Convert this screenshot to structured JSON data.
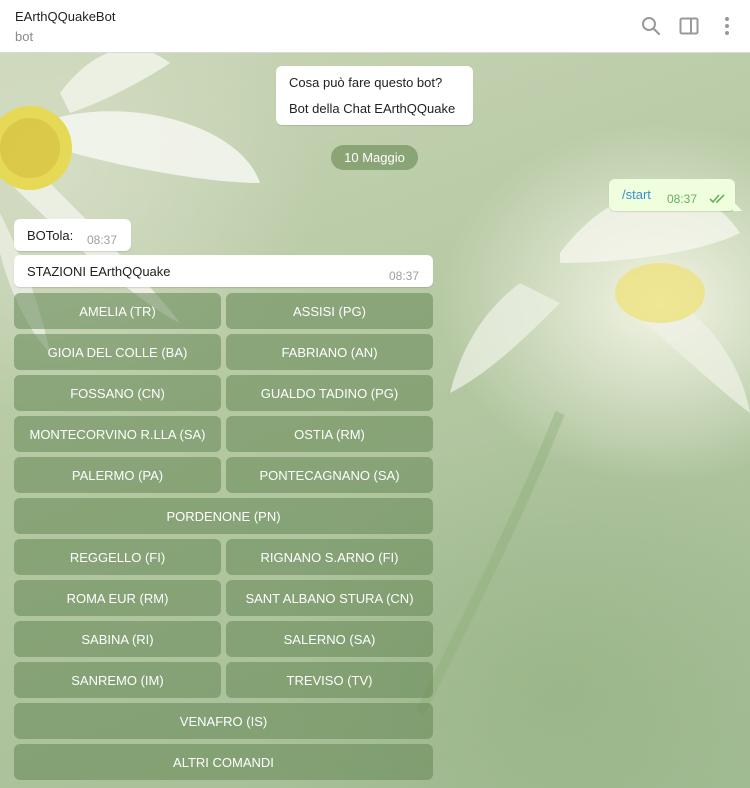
{
  "header": {
    "title": "EArthQQuakeBot",
    "subtitle": "bot",
    "icons": [
      "search-icon",
      "sidebar-toggle-icon",
      "more-vertical-icon"
    ]
  },
  "info": {
    "title": "Cosa può fare questo bot?",
    "text": "Bot della Chat EArthQQuake"
  },
  "date_label": "10 Maggio",
  "outgoing": {
    "text": "/start",
    "time": "08:37",
    "status_icon": "double-check-icon",
    "accent": "#6cad5f"
  },
  "incoming": [
    {
      "text": "BOTola:",
      "time": "08:37"
    },
    {
      "text": "STAZIONI EArthQQuake",
      "time": "08:37"
    }
  ],
  "keyboard": {
    "rows": [
      [
        "AMELIA (TR)",
        "ASSISI (PG)"
      ],
      [
        "GIOIA DEL COLLE (BA)",
        "FABRIANO (AN)"
      ],
      [
        "FOSSANO (CN)",
        "GUALDO TADINO (PG)"
      ],
      [
        "MONTECORVINO R.LLA (SA)",
        "OSTIA (RM)"
      ],
      [
        "PALERMO (PA)",
        "PONTECAGNANO (SA)"
      ],
      [
        "PORDENONE (PN)"
      ],
      [
        "REGGELLO (FI)",
        "RIGNANO S.ARNO (FI)"
      ],
      [
        "ROMA EUR (RM)",
        "SANT ALBANO STURA (CN)"
      ],
      [
        "SABINA (RI)",
        "SALERNO (SA)"
      ],
      [
        "SANREMO (IM)",
        "TREVISO (TV)"
      ],
      [
        "VENAFRO (IS)"
      ],
      [
        "ALTRI COMANDI"
      ]
    ]
  }
}
